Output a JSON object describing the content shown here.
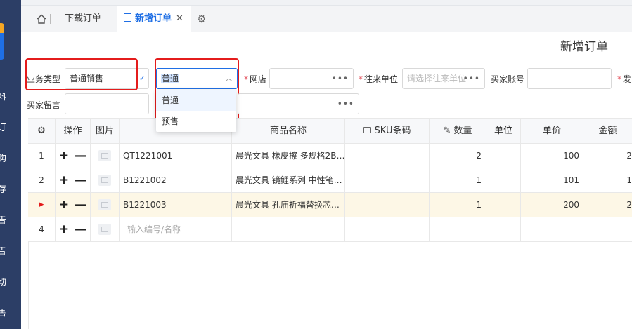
{
  "sidebar": {
    "items": [
      "料",
      "订",
      "购",
      "存",
      "告",
      "告",
      "动",
      "售"
    ]
  },
  "tabs": {
    "download_orders": "下载订单",
    "new_order": "新增订单",
    "close": "✕"
  },
  "page": {
    "title": "新增订单"
  },
  "form": {
    "business_type_label": "业务类型",
    "business_type_value": "普通销售",
    "order_kind_value": "普通",
    "shop_label": "网店",
    "partner_label": "往来单位",
    "partner_placeholder": "请选择往来单位",
    "buyer_account_label": "买家账号",
    "ship_label": "发",
    "buyer_message_label": "买家留言",
    "dots": "•••",
    "required_mark": "*"
  },
  "dropdown": {
    "options": [
      "普通",
      "预售"
    ]
  },
  "table": {
    "headers": {
      "ops": "操作",
      "image": "图片",
      "name": "商品名称",
      "sku": "SKU条码",
      "qty": "数量",
      "unit": "单位",
      "price": "单价",
      "amount": "金额"
    },
    "rows": [
      {
        "index": "1",
        "code": "QT1221001",
        "name": "晨光文具 橡皮擦 多规格2B…",
        "qty": "2",
        "price": "100",
        "amount": "2"
      },
      {
        "index": "2",
        "code": "B1221002",
        "name": "晨光文具 镜鲤系列 中性笔…",
        "qty": "1",
        "price": "101",
        "amount": "1"
      },
      {
        "index": "▶",
        "code": "B1221003",
        "name": "晨光文具 孔庙祈福替换芯…",
        "qty": "1",
        "price": "200",
        "amount": "2"
      },
      {
        "index": "4",
        "code_placeholder": "输入编号/名称"
      }
    ],
    "op_plus": "+",
    "op_minus": "—"
  }
}
